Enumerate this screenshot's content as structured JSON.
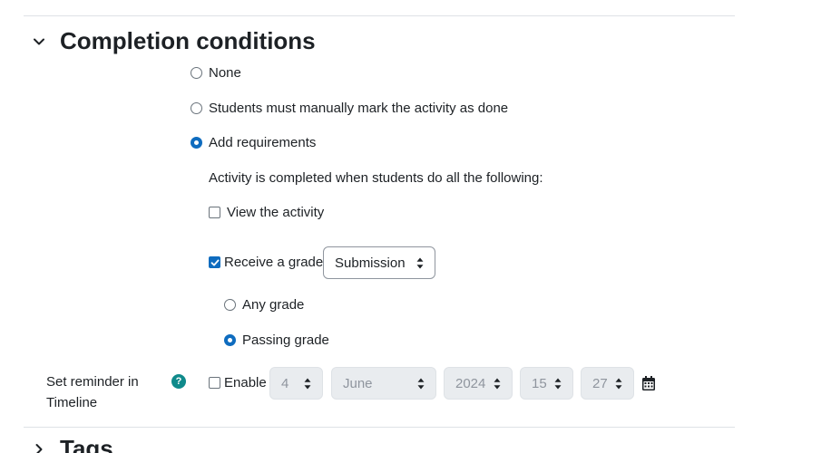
{
  "completion": {
    "title": "Completion conditions",
    "options": {
      "none": "None",
      "manual": "Students must manually mark the activity as done",
      "requirements": "Add requirements"
    },
    "requirements_intro": "Activity is completed when students do all the following:",
    "view_activity": "View the activity",
    "receive_grade": "Receive a grade",
    "grade_item_select": "Submission",
    "any_grade": "Any grade",
    "passing_grade": "Passing grade"
  },
  "reminder": {
    "label_line1": "Set reminder in",
    "label_line2": "Timeline",
    "help_glyph": "?",
    "enable_label": "Enable",
    "day": "4",
    "month": "June",
    "year": "2024",
    "hour": "15",
    "minute": "27"
  },
  "tags": {
    "title": "Tags"
  },
  "colors": {
    "accent": "#0f6cbf",
    "help": "#0f8a8b",
    "divider": "#dee2e6"
  },
  "icons": {
    "section_toggle": "chevron-down-icon",
    "tags_toggle": "chevron-right-icon",
    "calendar": "calendar-icon",
    "help": "question-circle-icon"
  }
}
